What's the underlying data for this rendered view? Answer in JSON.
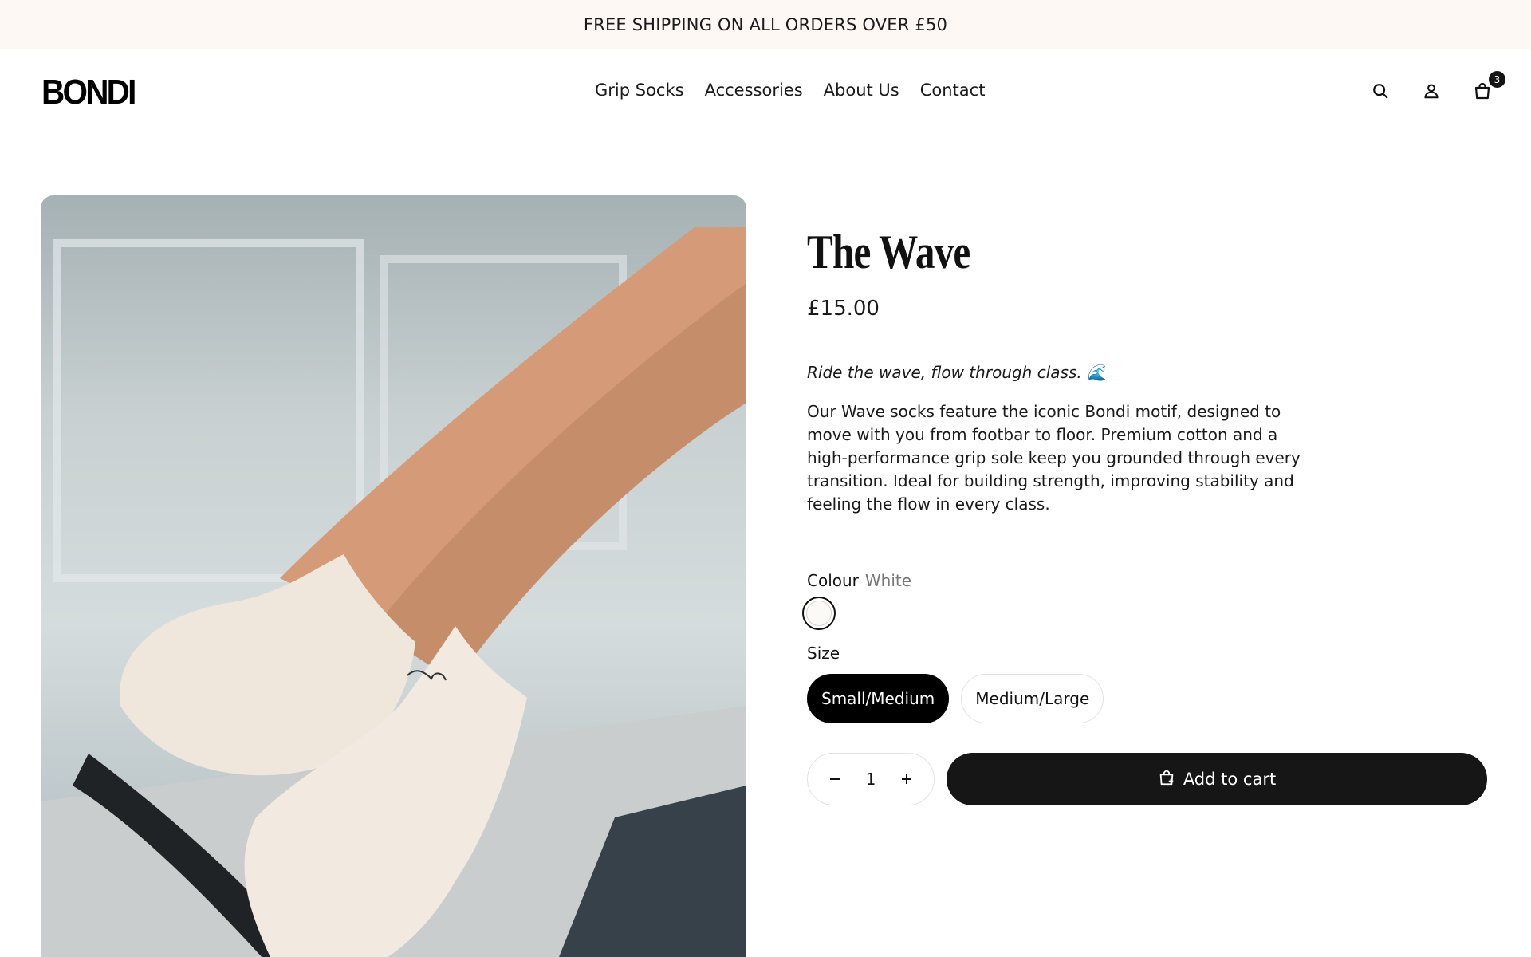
{
  "announcement": "FREE SHIPPING ON ALL ORDERS OVER £50",
  "brand": "BONDI",
  "nav": [
    "Grip Socks",
    "Accessories",
    "About Us",
    "Contact"
  ],
  "header_icons": {
    "search": "search-icon",
    "account": "user-icon",
    "cart": "cart-icon"
  },
  "cart_count": "3",
  "product": {
    "title": "The Wave",
    "price": "£15.00",
    "tagline": "Ride the wave, flow through class. 🌊",
    "description": "Our Wave socks feature the iconic Bondi motif, designed to move with you from footbar to floor. Premium cotton and a high-performance grip sole keep you grounded through every transition. Ideal for building strength, improving stability and feeling the flow in every class.",
    "colour_label": "Colour",
    "colour_value": "White",
    "size_label": "Size",
    "sizes": [
      "Small/Medium",
      "Medium/Large"
    ],
    "selected_size": "Small/Medium",
    "quantity": "1",
    "add_to_cart": "Add to cart"
  },
  "colors": {
    "announcement_bg": "#fdf8f4",
    "button_dark": "#161616",
    "swatch_white": "#fbfaf6"
  }
}
